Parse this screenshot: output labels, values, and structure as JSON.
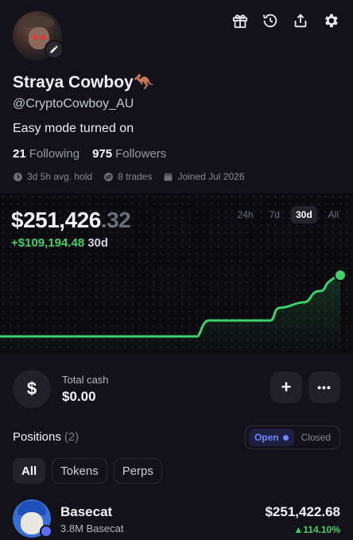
{
  "header": {
    "icons": [
      "gift-icon",
      "history-icon",
      "share-icon",
      "settings-icon"
    ]
  },
  "profile": {
    "name": "Straya Cowboy🦘",
    "handle": "@CryptoCowboy_AU",
    "bio": "Easy mode turned on",
    "following_count": "21",
    "following_label": "Following",
    "followers_count": "975",
    "followers_label": "Followers",
    "avg_hold": "3d 5h avg. hold",
    "trades": "8 trades",
    "joined": "Joined Jul 2026"
  },
  "portfolio": {
    "balance_main": "$251,426",
    "balance_cents": ".32",
    "change_value": "+$109,194.48",
    "change_period": "30d",
    "ranges": [
      "24h",
      "7d",
      "30d",
      "All"
    ],
    "active_range": "30d",
    "accent": "#3fd06a"
  },
  "cash": {
    "icon_symbol": "$",
    "label": "Total cash",
    "value": "$0.00",
    "add_symbol": "+",
    "more_symbol": "•••"
  },
  "positions": {
    "title": "Positions",
    "count": "(2)",
    "toggle": [
      "Open",
      "Closed"
    ],
    "filters": [
      "All",
      "Tokens",
      "Perps"
    ],
    "items": [
      {
        "name": "Basecat",
        "amount": "3.8M Basecat",
        "value": "$251,422.68",
        "change": "▲114.10%"
      }
    ]
  }
}
